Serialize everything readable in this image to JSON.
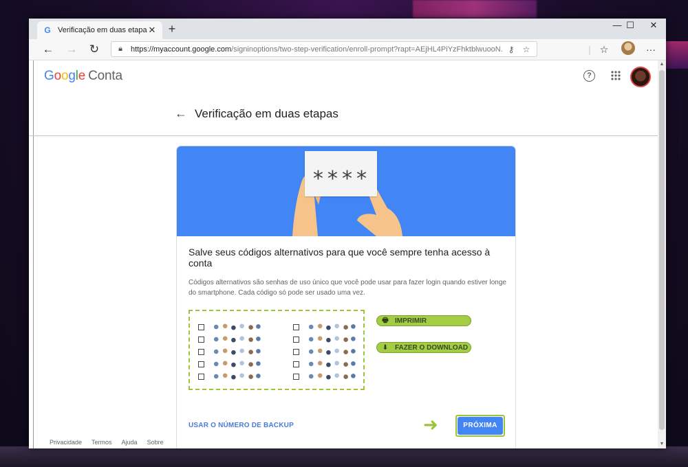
{
  "browser": {
    "tab_title": "Verificação em duas etapas",
    "tab_favicon": "G",
    "url_host": "https://myaccount.google.com",
    "url_path": "/signinoptions/two-step-verification/enroll-prompt?rapt=AEjHL4PiYzFhktblwuooN..."
  },
  "header": {
    "logo_google": [
      "G",
      "o",
      "o",
      "g",
      "l",
      "e"
    ],
    "logo_colors": [
      "#4285f4",
      "#ea4335",
      "#fbbc05",
      "#4285f4",
      "#34a853",
      "#ea4335"
    ],
    "logo_product": "Conta",
    "help_icon": "?",
    "apps_icon": "⋮⋮⋮"
  },
  "subheader": {
    "title": "Verificação em duas etapas"
  },
  "hero": {
    "stars": "****"
  },
  "card": {
    "title": "Salve seus códigos alternativos para que você sempre tenha acesso à conta",
    "description": "Códigos alternativos são senhas de uso único que você pode usar para fazer login quando estiver longe do smartphone. Cada código só pode ser usado uma vez.",
    "print_label": "IMPRIMIR",
    "download_label": "FAZER O DOWNLOAD",
    "backup_link": "USAR O NÚMERO DE BACKUP",
    "next_label": "PRÓXIMA"
  },
  "footer": {
    "links": [
      "Privacidade",
      "Termos",
      "Ajuda",
      "Sobre"
    ]
  },
  "colors": {
    "accent_blue": "#4285f4",
    "highlight_green": "#9cc43a"
  }
}
